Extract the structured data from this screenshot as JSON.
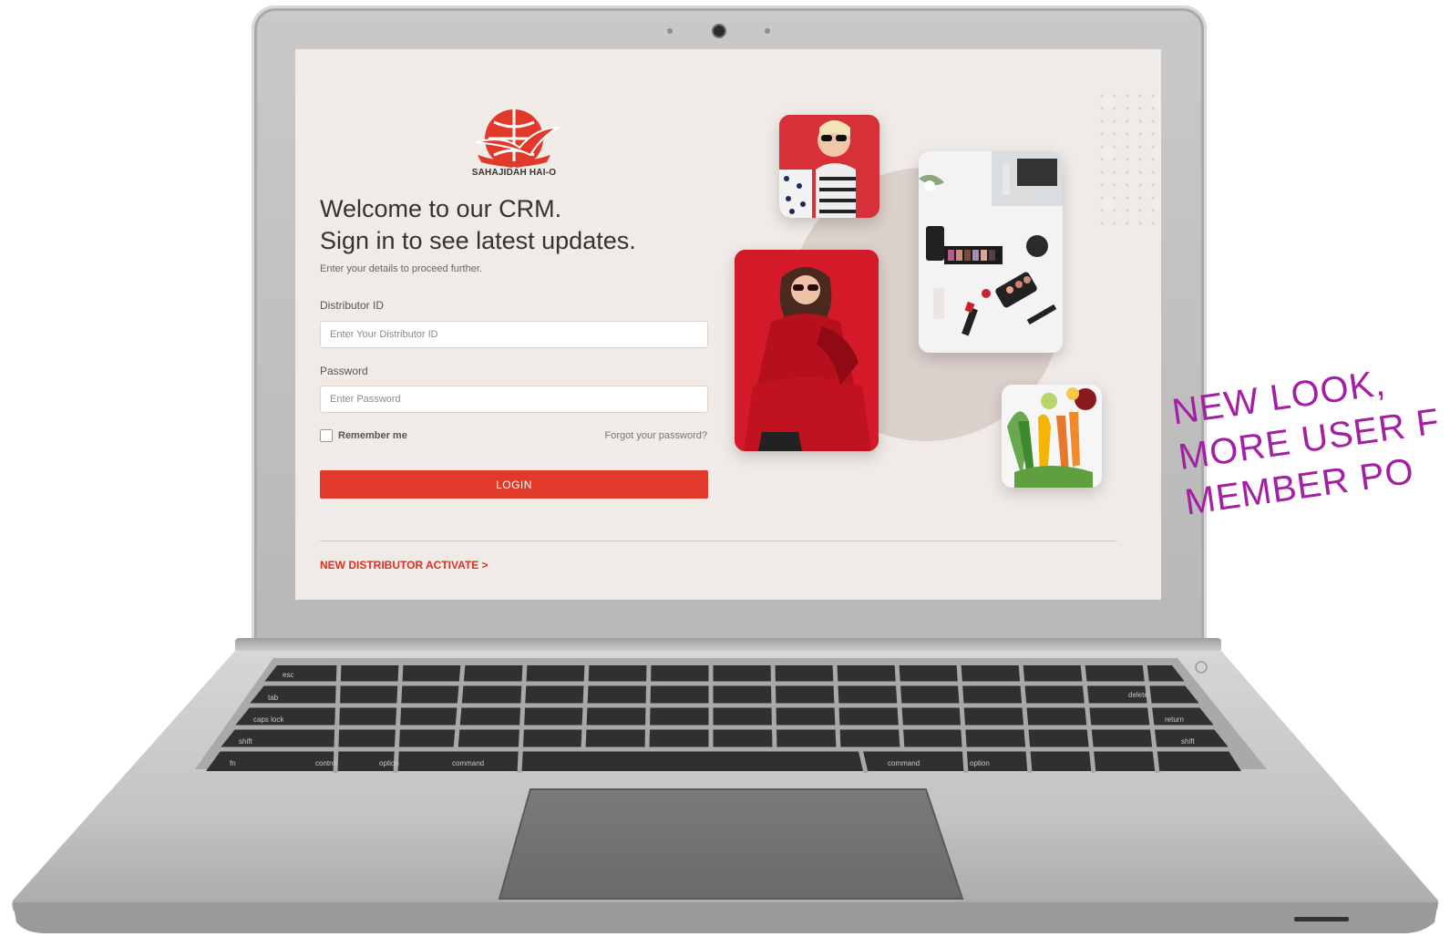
{
  "brand": {
    "name": "SAHAJIDAH HAI-O",
    "color": "#e13a2b"
  },
  "login": {
    "heading_line1": "Welcome to our CRM.",
    "heading_line2": "Sign in to see latest updates.",
    "subtitle": "Enter your details to proceed further.",
    "distributor_label": "Distributor ID",
    "distributor_placeholder": "Enter Your Distributor ID",
    "password_label": "Password",
    "password_placeholder": "Enter Password",
    "remember_label": "Remember me",
    "forgot_label": "Forgot your password?",
    "login_button": "LOGIN",
    "activate_link": "NEW DISTRIBUTOR ACTIVATE >"
  },
  "collage": {
    "images": [
      "woman-with-sunglasses-photo",
      "cosmetics-flatlay-photo",
      "woman-in-red-photo",
      "vegetables-photo"
    ]
  },
  "promo": {
    "line1": "NEW LOOK,",
    "line2": "MORE USER F",
    "line3": "MEMBER PO",
    "color": "#a31fa3"
  },
  "keyboard": {
    "row1": [
      "esc",
      "delete"
    ],
    "row2": [
      "tab"
    ],
    "row3": [
      "caps lock",
      "return"
    ],
    "row4": [
      "shift",
      "shift"
    ],
    "row5": [
      "fn",
      "control",
      "option",
      "command",
      "command",
      "option"
    ]
  }
}
